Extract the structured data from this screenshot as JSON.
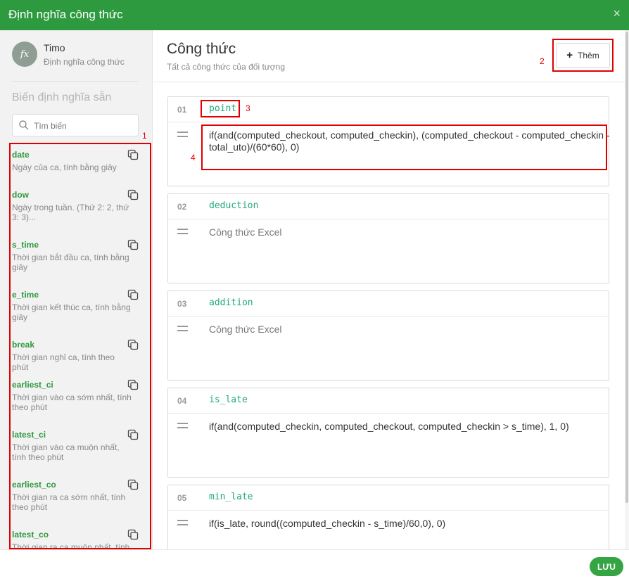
{
  "dialog": {
    "title": "Định nghĩa công thức",
    "close_glyph": "×"
  },
  "app": {
    "avatar_text": "fx",
    "name": "Timo",
    "subtitle": "Định nghĩa công thức"
  },
  "sidebar": {
    "heading": "Biến định nghĩa sẵn",
    "search": {
      "placeholder": "Tìm biến",
      "value": ""
    },
    "items": [
      {
        "name": "date",
        "desc": "Ngày của ca, tính bằng giây"
      },
      {
        "name": "dow",
        "desc": "Ngày trong tuần. (Thứ 2: 2, thứ 3: 3)..."
      },
      {
        "name": "s_time",
        "desc": "Thời gian bắt đầu ca, tính bằng giây"
      },
      {
        "name": "e_time",
        "desc": "Thời gian kết thúc ca, tính bằng giây"
      },
      {
        "name": "break",
        "desc": "Thời gian nghỉ ca, tính theo phút"
      },
      {
        "name": "earliest_ci",
        "desc": "Thời gian vào ca sớm nhất, tính theo phút"
      },
      {
        "name": "latest_ci",
        "desc": "Thời gian vào ca muộn nhất, tính theo phút"
      },
      {
        "name": "earliest_co",
        "desc": "Thời gian ra ca sớm nhất, tính theo phút"
      },
      {
        "name": "latest_co",
        "desc": "Thời gian ra ca muộn nhất, tính theo phút"
      }
    ]
  },
  "main": {
    "title": "Công thức",
    "subtitle": "Tất cả công thức của đối tượng",
    "add_label": "Thêm",
    "formulas": [
      {
        "num": "01",
        "name": "point",
        "formula": "if(and(computed_checkout, computed_checkin), (computed_checkout - computed_checkin - total_uto)/(60*60), 0)"
      },
      {
        "num": "02",
        "name": "deduction",
        "formula": "Công thức Excel"
      },
      {
        "num": "03",
        "name": "addition",
        "formula": "Công thức Excel"
      },
      {
        "num": "04",
        "name": "is_late",
        "formula": "if(and(computed_checkin, computed_checkout, computed_checkin > s_time), 1, 0)"
      },
      {
        "num": "05",
        "name": "min_late",
        "formula": "if(is_late, round((computed_checkin - s_time)/60,0), 0)"
      }
    ]
  },
  "annotations": {
    "a1": "1",
    "a2": "2",
    "a3": "3",
    "a4": "4"
  },
  "footer": {
    "save_label": "LƯU"
  },
  "colors": {
    "brand_green": "#2e9a3f",
    "highlight_red": "#e00000",
    "variable_green": "#1fa97a"
  }
}
